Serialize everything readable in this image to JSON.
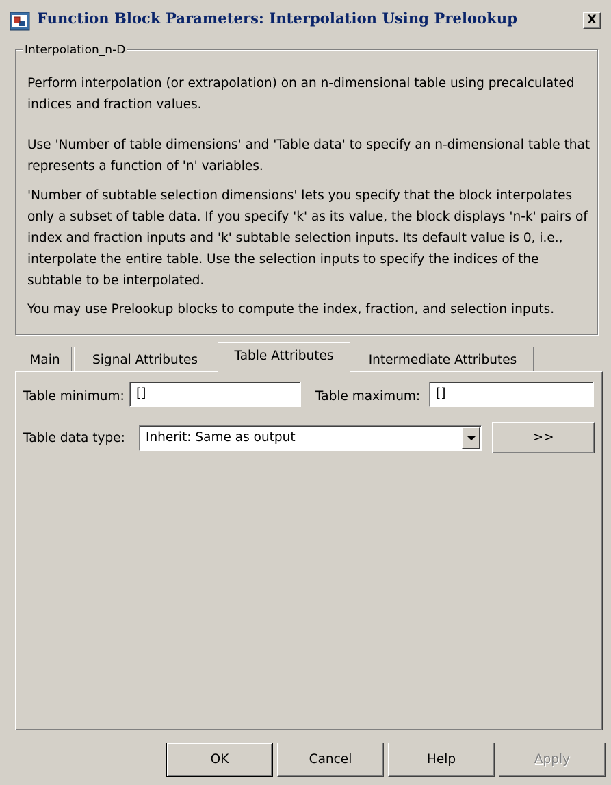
{
  "window": {
    "title": "Function Block Parameters: Interpolation Using Prelookup",
    "close_label": "X"
  },
  "group": {
    "legend": "Interpolation_n-D",
    "paragraphs": [
      "Perform interpolation (or extrapolation) on an n-dimensional table using precalculated indices and fraction values.",
      "Use 'Number of table dimensions' and 'Table data' to specify an n-dimensional table that represents a function of 'n' variables.",
      "'Number of subtable selection dimensions' lets you specify that the block interpolates only a subset of table data. If you specify 'k' as its value, the block displays 'n-k' pairs of index and fraction inputs and 'k' subtable selection inputs. Its default value is 0, i.e., interpolate the entire table. Use the selection inputs to specify the indices of the subtable to be interpolated.",
      "You may use Prelookup blocks to compute the index, fraction, and selection inputs."
    ]
  },
  "tabs": [
    {
      "label": "Main"
    },
    {
      "label": "Signal Attributes"
    },
    {
      "label": "Table Attributes"
    },
    {
      "label": "Intermediate Attributes"
    }
  ],
  "active_tab": "Table Attributes",
  "fields": {
    "table_min_label": "Table minimum:",
    "table_min_value": "[]",
    "table_max_label": "Table maximum:",
    "table_max_value": "[]",
    "data_type_label": "Table data type:",
    "data_type_value": "Inherit: Same as output",
    "assistant_label": ">>"
  },
  "buttons": {
    "ok": {
      "mnemonic": "O",
      "rest": "K"
    },
    "cancel": {
      "mnemonic": "C",
      "rest": "ancel"
    },
    "help": {
      "mnemonic": "H",
      "rest": "elp"
    },
    "apply": {
      "mnemonic": "A",
      "rest": "pply"
    }
  },
  "icons": {
    "app_icon": "simulink-block-icon",
    "close": "close-icon",
    "dropdown": "chevron-down-icon"
  },
  "colors": {
    "title_text": "#0a246a",
    "window_bg": "#d4d0c8",
    "icon_blue": "#3a6ea5",
    "icon_red": "#c0392b"
  }
}
